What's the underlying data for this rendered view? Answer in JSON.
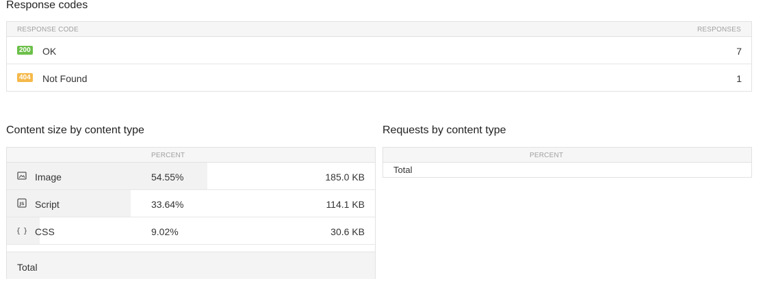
{
  "response_codes": {
    "title": "Response codes",
    "header": {
      "code": "RESPONSE CODE",
      "responses": "RESPONSES"
    },
    "rows": [
      {
        "code": "200",
        "label": "OK",
        "count": "7",
        "color": "#6cc04a"
      },
      {
        "code": "404",
        "label": "Not Found",
        "count": "1",
        "color": "#f5b94a"
      }
    ]
  },
  "content_size": {
    "title": "Content size by content type",
    "header": {
      "percent": "PERCENT"
    },
    "rows": [
      {
        "icon": "image-icon",
        "label": "Image",
        "percent": "54.55%",
        "size": "185.0 KB",
        "fraction": 0.5455
      },
      {
        "icon": "js-script-icon",
        "label": "Script",
        "percent": "33.64%",
        "size": "114.1 KB",
        "fraction": 0.3364
      },
      {
        "icon": "css-braces-icon",
        "label": "CSS",
        "percent": "9.02%",
        "size": "30.6 KB",
        "fraction": 0.0902
      }
    ],
    "total_label": "Total"
  },
  "requests": {
    "title": "Requests by content type",
    "header": {
      "percent": "PERCENT"
    },
    "total_label": "Total"
  }
}
